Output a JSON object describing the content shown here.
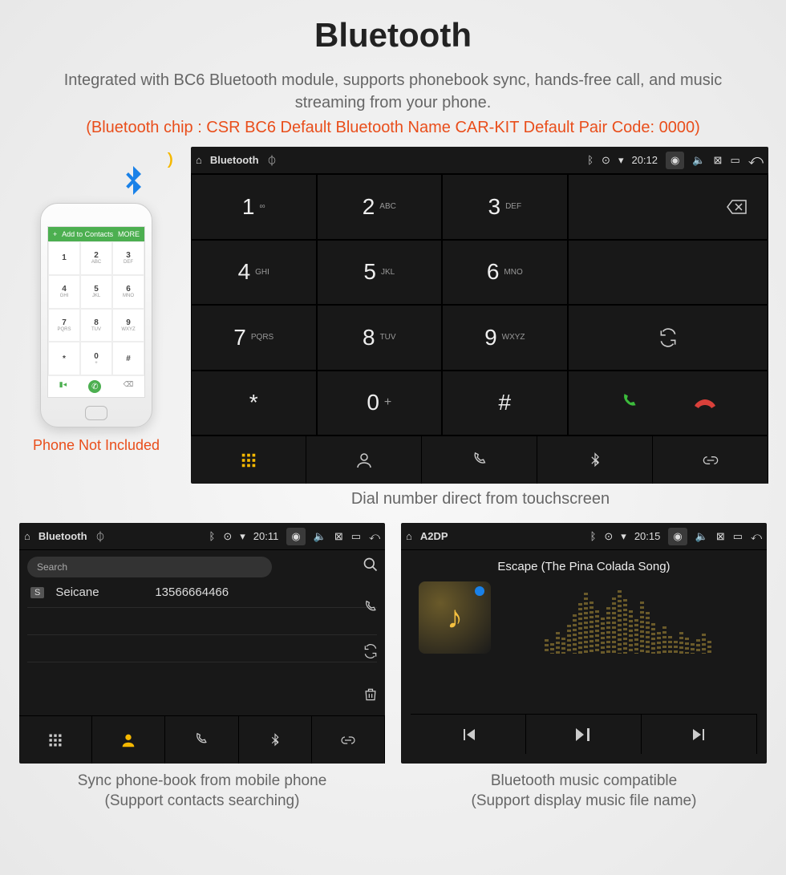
{
  "title": "Bluetooth",
  "subtitle": "Integrated with BC6 Bluetooth module, supports phonebook sync, hands-free call, and music streaming from your phone.",
  "redline": "(Bluetooth chip : CSR BC6     Default Bluetooth Name CAR-KIT     Default Pair Code: 0000)",
  "phone": {
    "greenbar_left": "+",
    "greenbar_text": "Add to Contacts",
    "greenbar_right": "MORE",
    "keys": [
      {
        "n": "1",
        "l": ""
      },
      {
        "n": "2",
        "l": "ABC"
      },
      {
        "n": "3",
        "l": "DEF"
      },
      {
        "n": "4",
        "l": "GHI"
      },
      {
        "n": "5",
        "l": "JKL"
      },
      {
        "n": "6",
        "l": "MNO"
      },
      {
        "n": "7",
        "l": "PQRS"
      },
      {
        "n": "8",
        "l": "TUV"
      },
      {
        "n": "9",
        "l": "WXYZ"
      },
      {
        "n": "*",
        "l": ""
      },
      {
        "n": "0",
        "l": "+"
      },
      {
        "n": "#",
        "l": ""
      }
    ],
    "caption": "Phone Not Included"
  },
  "dialer": {
    "status": {
      "app": "Bluetooth",
      "time": "20:12"
    },
    "keys": [
      {
        "n": "1",
        "l": "∞"
      },
      {
        "n": "2",
        "l": "ABC"
      },
      {
        "n": "3",
        "l": "DEF"
      },
      {
        "n": "4",
        "l": "GHI"
      },
      {
        "n": "5",
        "l": "JKL"
      },
      {
        "n": "6",
        "l": "MNO"
      },
      {
        "n": "7",
        "l": "PQRS"
      },
      {
        "n": "8",
        "l": "TUV"
      },
      {
        "n": "9",
        "l": "WXYZ"
      },
      {
        "n": "*",
        "l": ""
      },
      {
        "n": "0",
        "l": "+"
      },
      {
        "n": "#",
        "l": ""
      }
    ],
    "caption": "Dial number direct from touchscreen"
  },
  "contacts": {
    "status": {
      "app": "Bluetooth",
      "time": "20:11"
    },
    "search_placeholder": "Search",
    "row": {
      "letter": "S",
      "name": "Seicane",
      "number": "13566664466"
    },
    "caption_l1": "Sync phone-book from mobile phone",
    "caption_l2": "(Support contacts searching)"
  },
  "music": {
    "status": {
      "app": "A2DP",
      "time": "20:15"
    },
    "track": "Escape (The Pina Colada Song)",
    "caption_l1": "Bluetooth music compatible",
    "caption_l2": "(Support display music file name)"
  }
}
